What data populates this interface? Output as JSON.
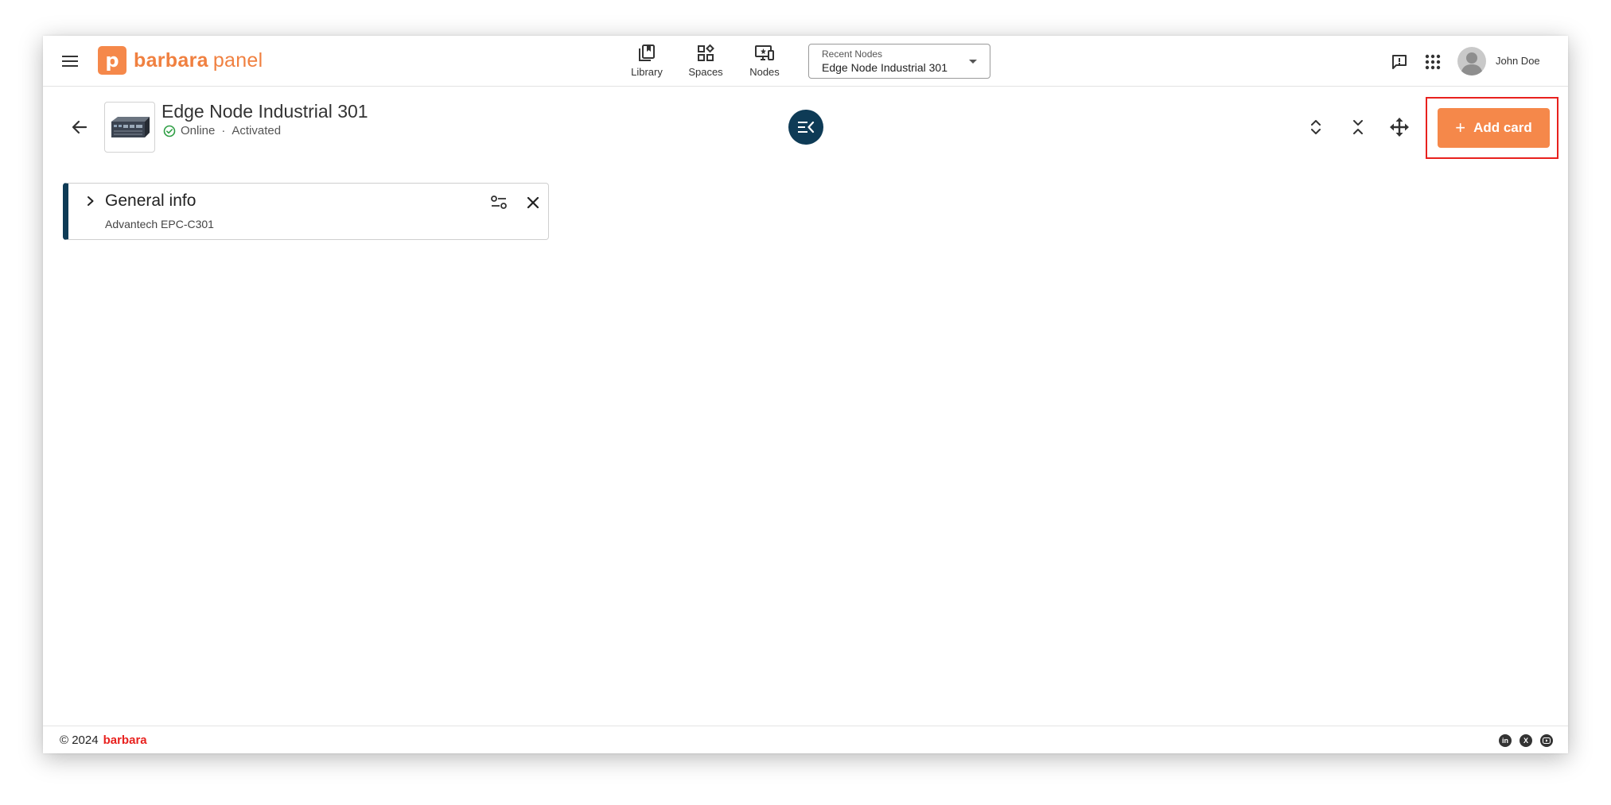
{
  "app": {
    "logo_letter": "p",
    "logo_brand": "barbara",
    "logo_product": "panel",
    "brand_color": "#f5884a"
  },
  "nav": {
    "items": [
      {
        "label": "Library",
        "icon": "library-icon"
      },
      {
        "label": "Spaces",
        "icon": "spaces-icon"
      },
      {
        "label": "Nodes",
        "icon": "nodes-icon"
      }
    ]
  },
  "recent_nodes": {
    "caption": "Recent Nodes",
    "value": "Edge Node Industrial 301"
  },
  "user": {
    "name": "John Doe"
  },
  "node": {
    "title": "Edge Node Industrial 301",
    "status": "Online",
    "separator": "·",
    "state": "Activated",
    "status_color": "#2e9e44"
  },
  "toolbar": {
    "add_card_label": "Add card",
    "add_card_color": "#f5884a",
    "highlight_color": "#e8211e"
  },
  "cards": [
    {
      "title": "General info",
      "subtitle": "Advantech EPC-C301",
      "accent": "#0e3b56"
    }
  ],
  "footer": {
    "copyright": "© 2024",
    "brand": "barbara",
    "social": [
      "linkedin-icon",
      "x-icon",
      "youtube-icon"
    ]
  }
}
